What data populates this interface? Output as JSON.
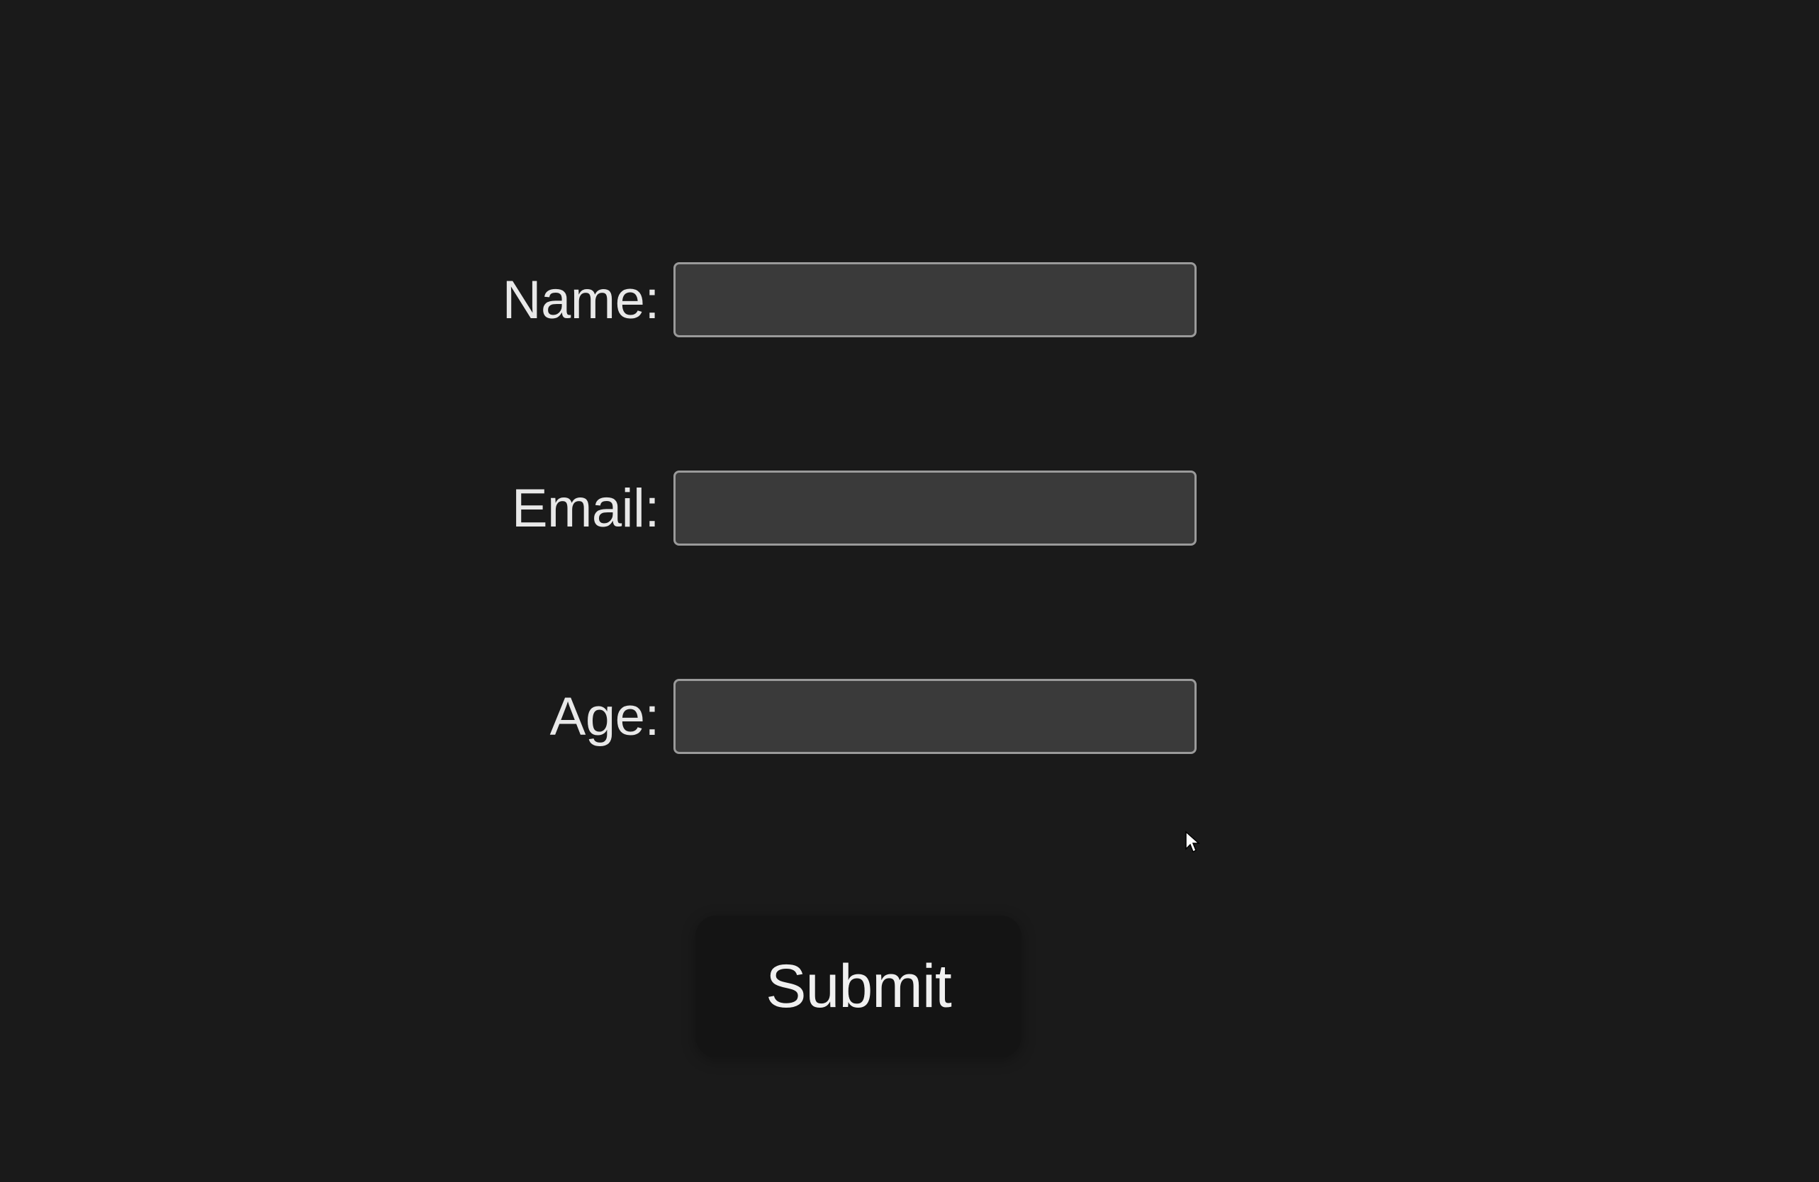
{
  "form": {
    "fields": {
      "name": {
        "label": "Name:",
        "value": ""
      },
      "email": {
        "label": "Email:",
        "value": ""
      },
      "age": {
        "label": "Age:",
        "value": ""
      }
    },
    "submit_label": "Submit"
  }
}
